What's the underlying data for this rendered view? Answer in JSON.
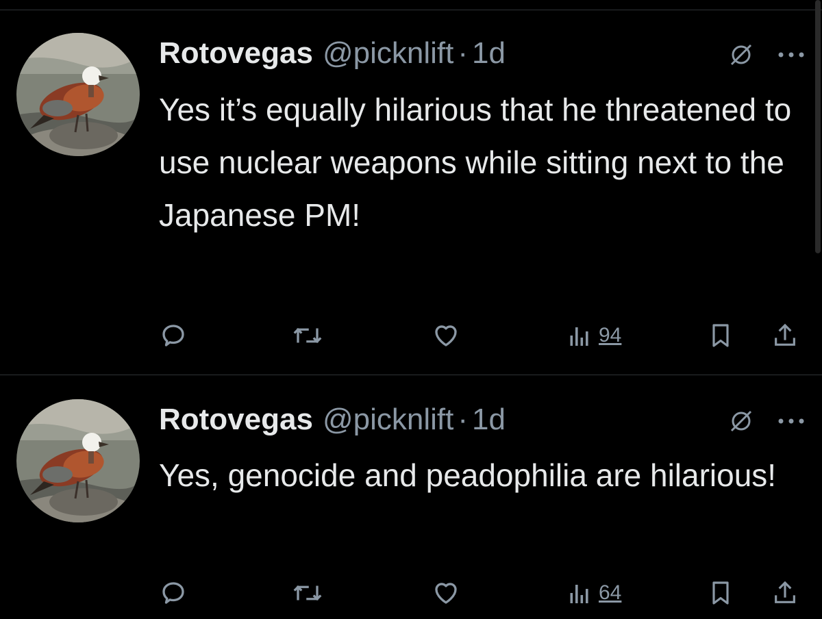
{
  "tweets": [
    {
      "author": {
        "display_name": "Rotovegas",
        "handle": "@picknlift",
        "avatar_icon": "duck-avatar"
      },
      "separator": "·",
      "time": "1d",
      "text": "Yes it’s equally hilarious that he threatened to use nuclear weapons while sitting next to the Japanese PM!",
      "views": "94",
      "icons": [
        "grok-icon",
        "more-icon",
        "reply-icon",
        "retweet-icon",
        "like-icon",
        "views-icon",
        "bookmark-icon",
        "share-icon"
      ]
    },
    {
      "author": {
        "display_name": "Rotovegas",
        "handle": "@picknlift",
        "avatar_icon": "duck-avatar"
      },
      "separator": "·",
      "time": "1d",
      "text": "Yes, genocide and peadophilia are hilarious!",
      "views": "64",
      "icons": [
        "grok-icon",
        "more-icon",
        "reply-icon",
        "retweet-icon",
        "like-icon",
        "views-icon",
        "bookmark-icon",
        "share-icon"
      ]
    }
  ],
  "colors": {
    "background": "#000000",
    "text_primary": "#e7e9ea",
    "text_secondary": "#8b98a5",
    "divider": "#2f3336"
  }
}
